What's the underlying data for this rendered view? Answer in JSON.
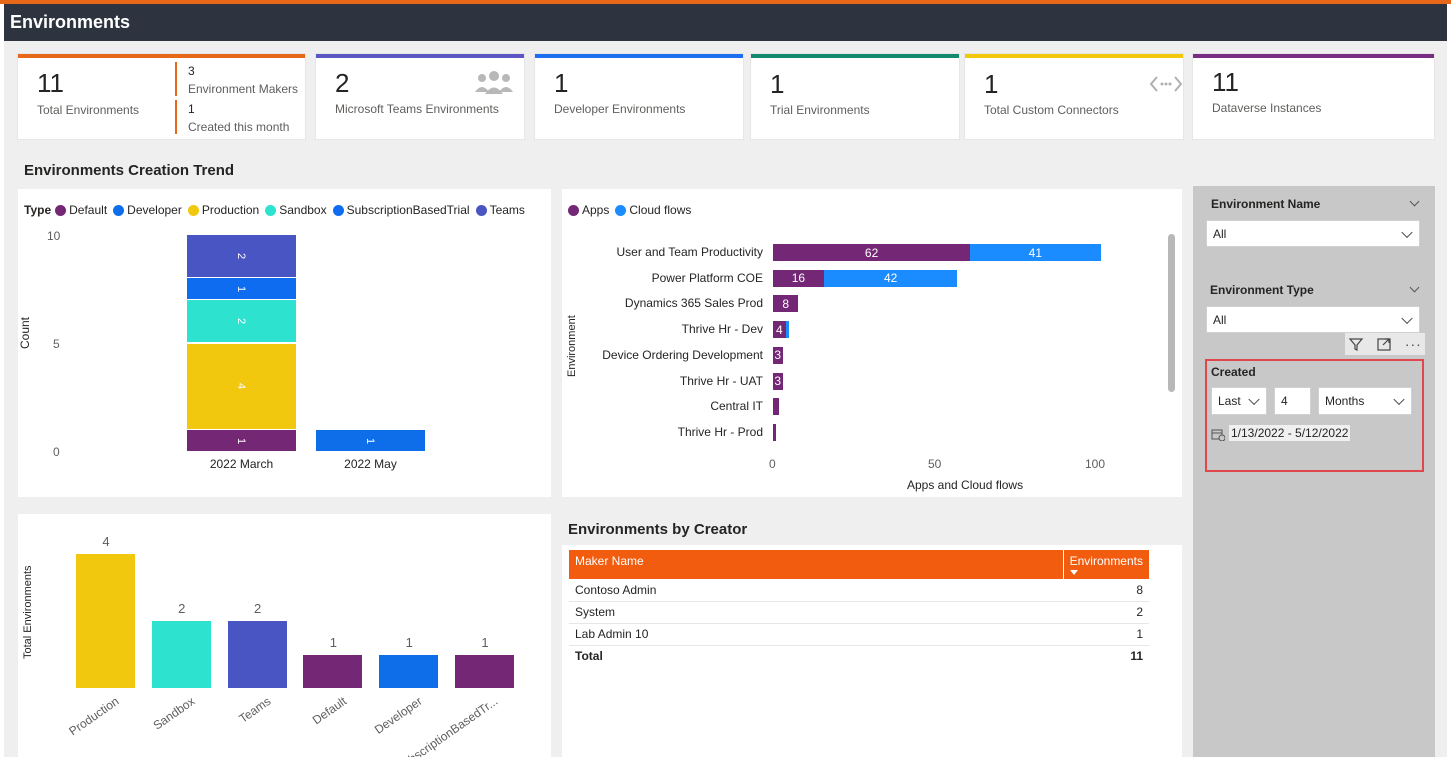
{
  "header": {
    "title": "Environments"
  },
  "colors": {
    "header_bg": "#2d333f",
    "accent_orange": "#f25c0f",
    "default": "#742774",
    "developer": "#0e6eea",
    "production": "#f2c80f",
    "sandbox": "#2ee2d0",
    "subscription": "#0d6cf0",
    "teams": "#4a55c4",
    "apps": "#742774",
    "cloud_flows": "#1a8cff"
  },
  "kpis": [
    {
      "value": "11",
      "label": "Total Environments",
      "bar": "#e8681a"
    },
    {
      "value": "2",
      "label": "Microsoft Teams Environments",
      "bar": "#5c56c4",
      "icon": "people-icon"
    },
    {
      "value": "1",
      "label": "Developer Environments",
      "bar": "#1e6ff0"
    },
    {
      "value": "1",
      "label": "Trial Environments",
      "bar": "#138a6d"
    },
    {
      "value": "1",
      "label": "Total Custom Connectors",
      "bar": "#f2c80f",
      "icon": "connector-icon"
    },
    {
      "value": "11",
      "label": "Dataverse Instances",
      "bar": "#7a2b82"
    }
  ],
  "kpi_sub": [
    {
      "value": "3",
      "label": "Environment Makers"
    },
    {
      "value": "1",
      "label": "Created this month"
    }
  ],
  "trend": {
    "title": "Environments Creation Trend",
    "legend_title": "Type",
    "legend": [
      "Default",
      "Developer",
      "Production",
      "Sandbox",
      "SubscriptionBasedTrial",
      "Teams"
    ],
    "ylabel": "Count",
    "yticks": [
      "10",
      "5",
      "0"
    ]
  },
  "apps_chart": {
    "legend": [
      "Apps",
      "Cloud flows"
    ],
    "ylabel": "Environment",
    "xlabel": "Apps and Cloud flows",
    "xticks": [
      "0",
      "50",
      "100"
    ]
  },
  "type_chart": {
    "ylabel": "Total Environments"
  },
  "creator": {
    "title": "Environments by Creator",
    "col_maker": "Maker Name",
    "col_envs": "Environments",
    "rows": [
      {
        "name": "Contoso Admin",
        "count": "8"
      },
      {
        "name": "System",
        "count": "2"
      },
      {
        "name": "Lab Admin 10",
        "count": "1"
      }
    ],
    "total_label": "Total",
    "total_value": "11"
  },
  "slicers": {
    "env_name": {
      "title": "Environment Name",
      "value": "All"
    },
    "env_type": {
      "title": "Environment Type",
      "value": "All"
    },
    "created": {
      "title": "Created",
      "mode": "Last",
      "count": "4",
      "unit": "Months",
      "range": "1/13/2022 - 5/12/2022"
    }
  },
  "chart_data": [
    {
      "type": "bar",
      "title": "Environments Creation Trend",
      "stacked": true,
      "categories": [
        "2022 March",
        "2022 May"
      ],
      "ylabel": "Count",
      "ylim": [
        0,
        10
      ],
      "series": [
        {
          "name": "Default",
          "values": [
            1,
            0
          ]
        },
        {
          "name": "Developer",
          "values": [
            0,
            1
          ]
        },
        {
          "name": "Production",
          "values": [
            4,
            0
          ]
        },
        {
          "name": "Sandbox",
          "values": [
            2,
            0
          ]
        },
        {
          "name": "SubscriptionBasedTrial",
          "values": [
            1,
            0
          ]
        },
        {
          "name": "Teams",
          "values": [
            2,
            0
          ]
        }
      ],
      "legend_position": "top"
    },
    {
      "type": "bar",
      "orientation": "horizontal",
      "stacked": true,
      "categories": [
        "User and Team Productivity",
        "Power Platform COE",
        "Dynamics 365 Sales Prod",
        "Thrive Hr - Dev",
        "Device Ordering Development",
        "Thrive Hr - UAT",
        "Central IT",
        "Thrive Hr - Prod"
      ],
      "xlabel": "Apps and Cloud flows",
      "ylabel": "Environment",
      "xlim": [
        0,
        110
      ],
      "series": [
        {
          "name": "Apps",
          "values": [
            62,
            16,
            8,
            4,
            3,
            3,
            2,
            1
          ]
        },
        {
          "name": "Cloud flows",
          "values": [
            41,
            42,
            0,
            1,
            0,
            0,
            0,
            0
          ]
        }
      ],
      "legend_position": "top-left"
    },
    {
      "type": "bar",
      "categories": [
        "Production",
        "Sandbox",
        "Teams",
        "Default",
        "Developer",
        "SubscriptionBasedTr..."
      ],
      "values": [
        4,
        2,
        2,
        1,
        1,
        1
      ],
      "ylabel": "Total Environments",
      "ylim": [
        0,
        4
      ]
    }
  ]
}
